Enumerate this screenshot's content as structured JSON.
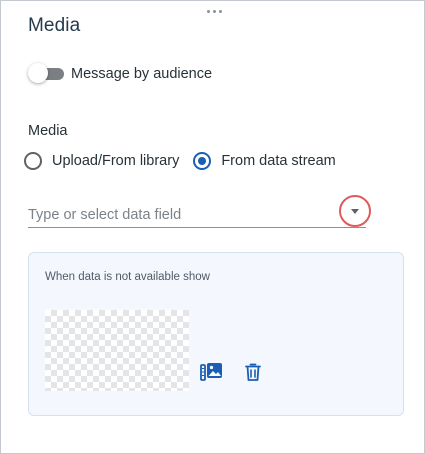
{
  "panel": {
    "title": "Media"
  },
  "toggle": {
    "label": "Message by audience",
    "checked": false
  },
  "media_section": {
    "label": "Media",
    "options": [
      {
        "label": "Upload/From library",
        "selected": false
      },
      {
        "label": "From data stream",
        "selected": true
      }
    ]
  },
  "data_field": {
    "placeholder": "Type or select data field",
    "value": ""
  },
  "fallback": {
    "label": "When data is not available show"
  },
  "icons": {
    "drag": "drag-handle-icon",
    "dropdown": "chevron-down-icon",
    "media_library": "media-library-icon",
    "delete": "trash-icon"
  },
  "colors": {
    "accent": "#1a5fb4",
    "highlight_ring": "#e05a5a",
    "fallback_bg": "#f4f8fe"
  }
}
